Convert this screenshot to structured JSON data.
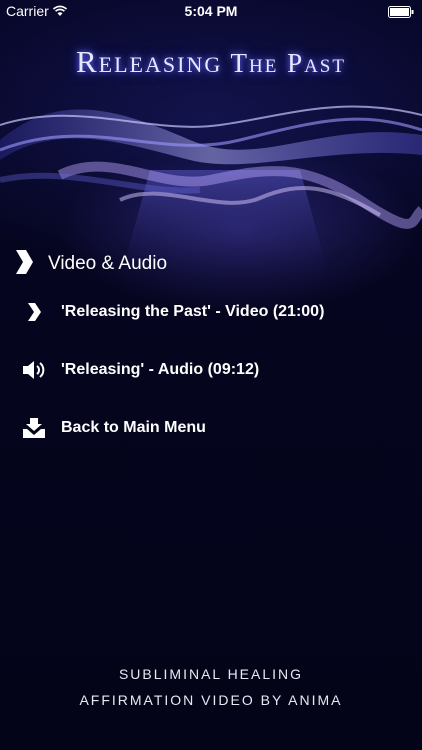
{
  "status_bar": {
    "carrier": "Carrier",
    "time": "5:04 PM"
  },
  "header": {
    "title_words": [
      "Releasing",
      "The",
      "Past"
    ]
  },
  "menu": {
    "section_label": "Video & Audio",
    "items": [
      {
        "label": "'Releasing the Past' - Video (21:00)",
        "icon": "chevron-right-icon"
      },
      {
        "label": "'Releasing' - Audio (09:12)",
        "icon": "speaker-icon"
      },
      {
        "label": "Back to Main Menu",
        "icon": "back-download-icon"
      }
    ]
  },
  "footer": {
    "line1": "SUBLIMINAL HEALING",
    "line2": "AFFIRMATION VIDEO BY ANIMA"
  },
  "colors": {
    "background": "#04041a",
    "title_glow": "#6a6cff",
    "wave": "#8e8cff"
  }
}
